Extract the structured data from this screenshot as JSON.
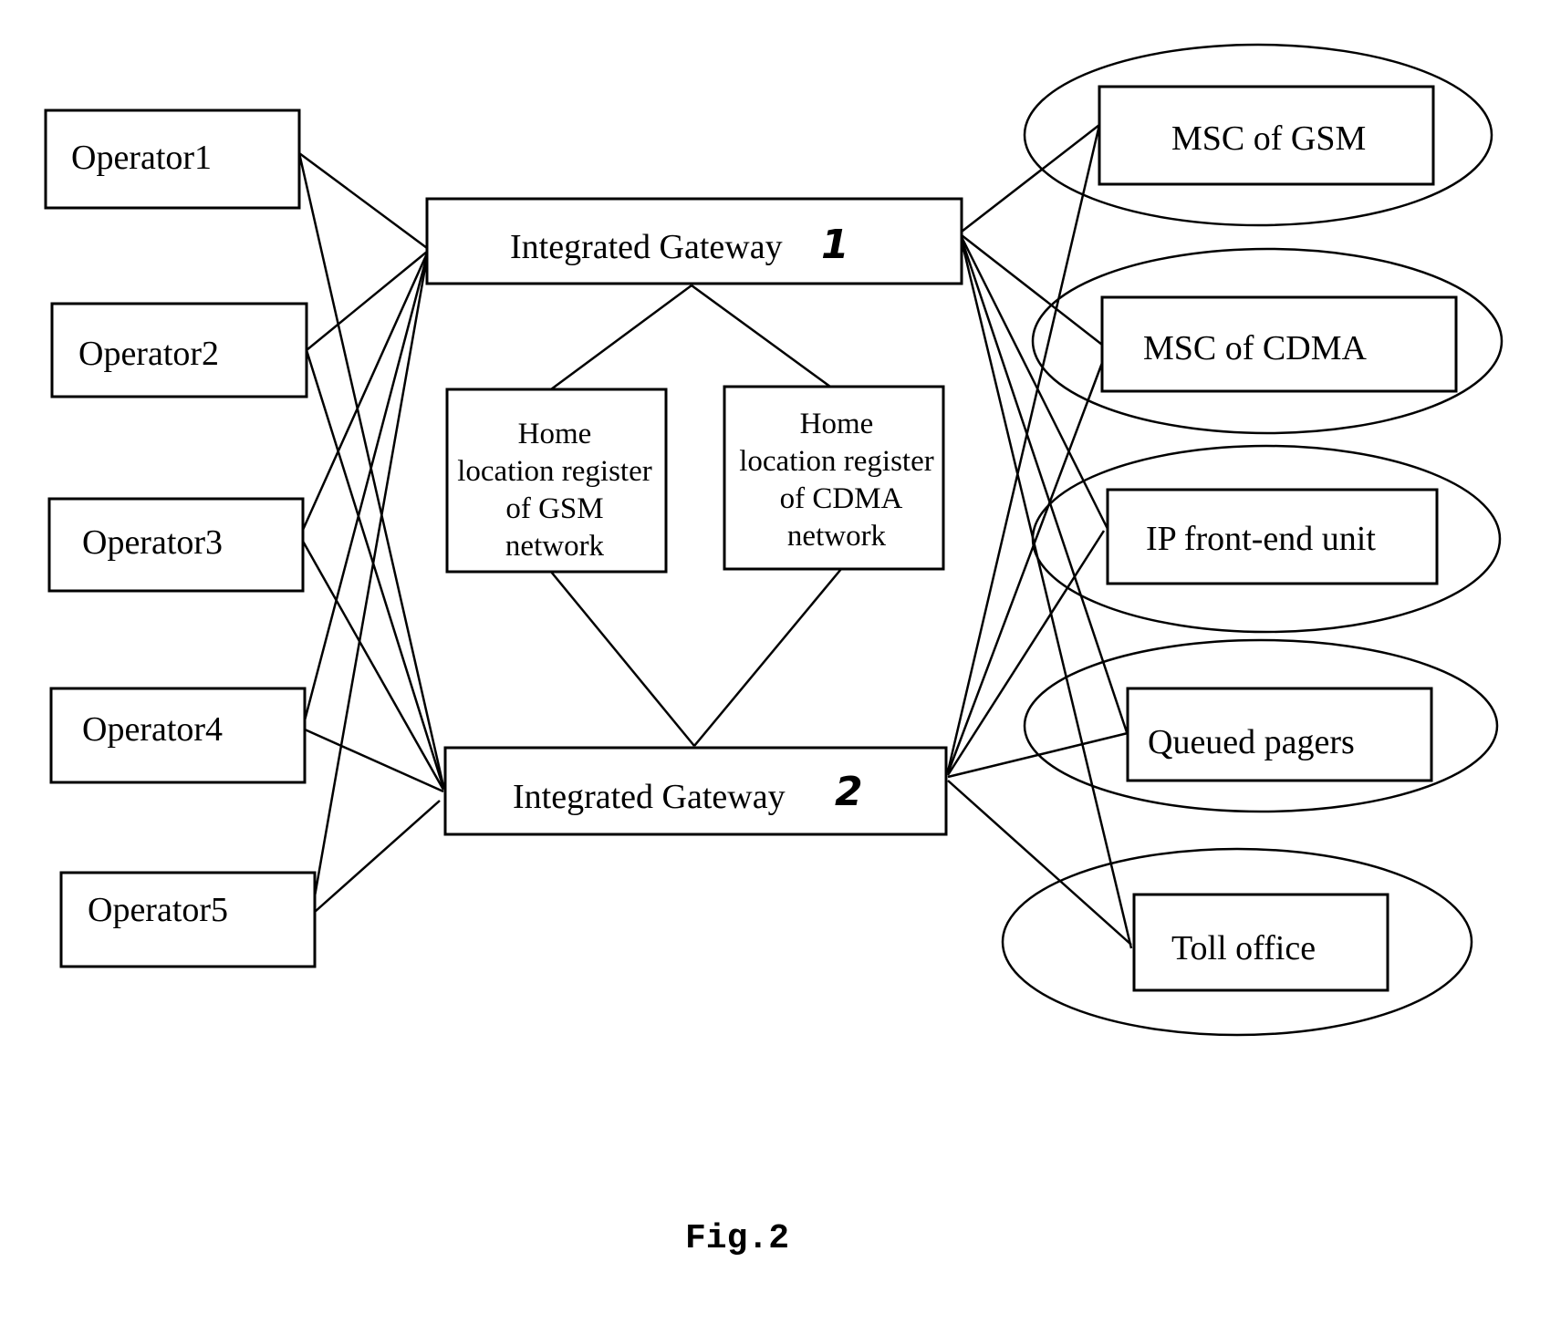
{
  "figure": {
    "caption": "Fig.2",
    "operators": [
      "Operator1",
      "Operator2",
      "Operator3",
      "Operator4",
      "Operator5"
    ],
    "gateways": [
      {
        "label": "Integrated Gateway",
        "number": "1"
      },
      {
        "label": "Integrated Gateway",
        "number": "2"
      }
    ],
    "hlr": [
      {
        "lines": [
          "Home",
          "location register",
          "of GSM",
          "network"
        ]
      },
      {
        "lines": [
          "Home",
          "location register",
          "of CDMA",
          "network"
        ]
      }
    ],
    "endpoints": [
      "MSC of GSM",
      "MSC of CDMA",
      "IP front-end unit",
      "Queued pagers",
      "Toll office"
    ]
  }
}
